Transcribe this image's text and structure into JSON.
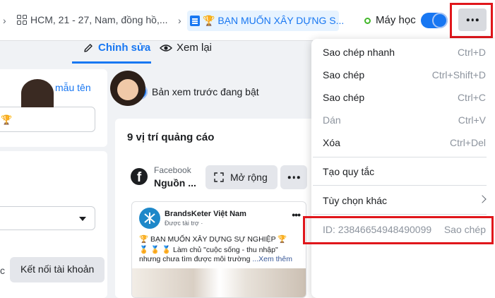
{
  "breadcrumb": {
    "campaign_group": "HCM, 21 - 27, Nam, đồng hồ,...",
    "ad_name": "🏆 BẠN MUỐN XÂY DỰNG S..."
  },
  "status": {
    "label": "Máy học",
    "toggle_on": true
  },
  "tabs": [
    {
      "label": "Chỉnh sửa",
      "active": true
    },
    {
      "label": "Xem lại",
      "active": false
    }
  ],
  "left_panel": {
    "create_template_link": "Tạo mẫu tên",
    "name_input_value": "🏆",
    "trailing_letter": "c",
    "connect_account_button": "Kết nối tài khoản"
  },
  "preview": {
    "toggle_label": "Bản xem trước đang bật",
    "toggle_on": true,
    "placements_title": "9 vị trí quảng cáo",
    "platform_name": "Facebook",
    "platform_sub": "Nguồn ...",
    "expand_button": "Mở rộng"
  },
  "post": {
    "page_name": "BrandsKeter Việt Nam",
    "sponsored": "Được tài trợ · ",
    "line1": "🏆 BẠN MUỐN XÂY DỰNG SỰ NGHIỆP 🏆",
    "line2": "🏅 🏅 🏅 Làm chủ \"cuộc sống - thu nhập\"",
    "line3": "nhưng chưa tìm được môi trường",
    "see_more": "...Xem thêm"
  },
  "menu": {
    "items": [
      {
        "label": "Sao chép nhanh",
        "shortcut": "Ctrl+D",
        "disabled": false
      },
      {
        "label": "Sao chép",
        "shortcut": "Ctrl+Shift+D",
        "disabled": false
      },
      {
        "label": "Sao chép",
        "shortcut": "Ctrl+C",
        "disabled": false
      },
      {
        "label": "Dán",
        "shortcut": "Ctrl+V",
        "disabled": true
      },
      {
        "label": "Xóa",
        "shortcut": "Ctrl+Del",
        "disabled": false
      }
    ],
    "create_rule": "Tạo quy tắc",
    "more_options": "Tùy chọn khác",
    "id_text": "ID: 23846654948490099",
    "copy_id": "Sao chép"
  },
  "colors": {
    "accent": "#1877f2",
    "highlight_box": "#e0161b",
    "status_green": "#42b72a"
  }
}
